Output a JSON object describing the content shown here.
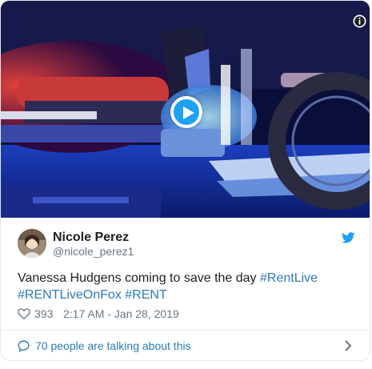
{
  "tweet": {
    "author_name": "Nicole Perez",
    "author_handle": "@nicole_perez1",
    "text_prefix": "Vanessa Hudgens coming to save the day ",
    "hashtags": [
      "#RentLive",
      "#RENTLiveOnFox",
      "#RENT"
    ],
    "like_count": "393",
    "timestamp": "2:17 AM - Jan 28, 2019",
    "conversation_text": "70 people are talking about this"
  },
  "icons": {
    "info": "info-icon",
    "play": "play-icon",
    "twitter": "twitter-bird-icon",
    "heart": "heart-icon",
    "speech": "speech-bubble-icon",
    "chevron": "chevron-right-icon"
  },
  "colors": {
    "accent": "#1da1f2",
    "link": "#2b7bb9",
    "text": "#1c2022",
    "muted": "#697882",
    "border": "#e1e8ed"
  }
}
